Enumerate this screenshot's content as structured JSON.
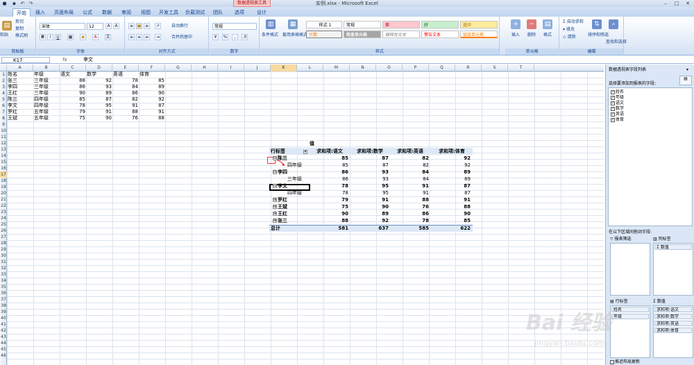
{
  "window": {
    "title": "实例.xlsx - Microsoft Excel",
    "context_tab": "数据透视表工具"
  },
  "tabs": [
    "开始",
    "插入",
    "页面布局",
    "公式",
    "数据",
    "审阅",
    "视图",
    "开发工具",
    "负载测试",
    "团队",
    "选项",
    "设计"
  ],
  "ribbon": {
    "clipboard": {
      "label": "剪贴板",
      "paste": "粘贴",
      "cut": "剪切",
      "copy": "复制",
      "format_painter": "格式刷"
    },
    "font": {
      "label": "字体",
      "name": "宋体",
      "size": "12"
    },
    "alignment": {
      "label": "对齐方式",
      "wrap": "自动换行",
      "merge": "合并后居中"
    },
    "number": {
      "label": "数字",
      "format": "常规"
    },
    "styles": {
      "label": "样式",
      "cond_format": "条件格式",
      "table_format": "套用表格格式",
      "items": [
        "样式 1",
        "常规",
        "差",
        "好",
        "适中",
        "计算",
        "检查单元格",
        "解释性文本",
        "警告文本",
        "链接单元格"
      ]
    },
    "cells": {
      "label": "单元格",
      "insert": "插入",
      "delete": "删除",
      "format": "格式"
    },
    "editing": {
      "label": "编辑",
      "autosum": "自动求和",
      "fill": "填充",
      "clear": "清除",
      "sort": "排序和筛选",
      "find": "查找和选择"
    }
  },
  "formula_bar": {
    "name_box": "K17",
    "fx": "fx",
    "value": "李文"
  },
  "columns": [
    "A",
    "B",
    "C",
    "D",
    "E",
    "F",
    "G",
    "H",
    "I",
    "J",
    "K",
    "L",
    "M",
    "N",
    "O",
    "P",
    "Q",
    "R",
    "S",
    "T"
  ],
  "selected_column": "K",
  "selected_row": "17",
  "source_table": {
    "headers": [
      "姓名",
      "年级",
      "语文",
      "数学",
      "英语",
      "体育"
    ],
    "rows": [
      [
        "张三",
        "三年级",
        "88",
        "92",
        "78",
        "85"
      ],
      [
        "李四",
        "三年级",
        "86",
        "93",
        "84",
        "89"
      ],
      [
        "王红",
        "三年级",
        "90",
        "89",
        "86",
        "90"
      ],
      [
        "陈兰",
        "四年级",
        "85",
        "87",
        "82",
        "92"
      ],
      [
        "李文",
        "四年级",
        "78",
        "95",
        "91",
        "87"
      ],
      [
        "罗红",
        "五年级",
        "79",
        "91",
        "88",
        "91"
      ],
      [
        "王斌",
        "五年级",
        "75",
        "90",
        "76",
        "88"
      ]
    ]
  },
  "pivot": {
    "values_caption": "值",
    "row_label": "行标签",
    "headers": [
      "求和项:语文",
      "求和项:数学",
      "求和项:英语",
      "求和项:体育"
    ],
    "rows": [
      {
        "label": "陈兰",
        "bold": true,
        "sign": "⊟",
        "vals": [
          "85",
          "87",
          "82",
          "92"
        ]
      },
      {
        "label": "四年级",
        "bold": false,
        "vals": [
          "85",
          "87",
          "82",
          "92"
        ]
      },
      {
        "label": "李四",
        "bold": true,
        "sign": "⊟",
        "vals": [
          "86",
          "93",
          "84",
          "89"
        ]
      },
      {
        "label": "三年级",
        "bold": false,
        "vals": [
          "86",
          "93",
          "84",
          "89"
        ]
      },
      {
        "label": "李文",
        "bold": true,
        "sign": "⊟",
        "vals": [
          "78",
          "95",
          "91",
          "87"
        ]
      },
      {
        "label": "四年级",
        "bold": false,
        "vals": [
          "78",
          "95",
          "91",
          "87"
        ]
      },
      {
        "label": "罗红",
        "bold": true,
        "sign": "⊞",
        "vals": [
          "79",
          "91",
          "88",
          "91"
        ]
      },
      {
        "label": "王斌",
        "bold": true,
        "sign": "⊞",
        "vals": [
          "75",
          "90",
          "76",
          "88"
        ]
      },
      {
        "label": "王红",
        "bold": true,
        "sign": "⊞",
        "vals": [
          "90",
          "89",
          "86",
          "90"
        ]
      },
      {
        "label": "张三",
        "bold": true,
        "sign": "⊞",
        "vals": [
          "88",
          "92",
          "78",
          "85"
        ]
      }
    ],
    "total_label": "总计",
    "totals": [
      "581",
      "637",
      "585",
      "622"
    ]
  },
  "panel": {
    "title": "数据透视表字段列表",
    "choose": "选择要添加到报表的字段:",
    "fields": [
      "姓名",
      "年级",
      "语文",
      "数学",
      "英语",
      "体育"
    ],
    "drag_hint": "在以下区域间拖动字段:",
    "report_filter": "报表筛选",
    "column_labels": "列标签",
    "row_labels": "行标签",
    "values": "数值",
    "col_items": [
      "Σ 数值"
    ],
    "row_items": [
      "姓名",
      "年级"
    ],
    "value_items": [
      "求和项:语文",
      "求和项:数学",
      "求和项:英语",
      "求和项:体育"
    ],
    "defer": "推迟布局更新"
  },
  "watermark": {
    "main": "Bai 经验",
    "sub": "jingyan.baidu.com"
  }
}
